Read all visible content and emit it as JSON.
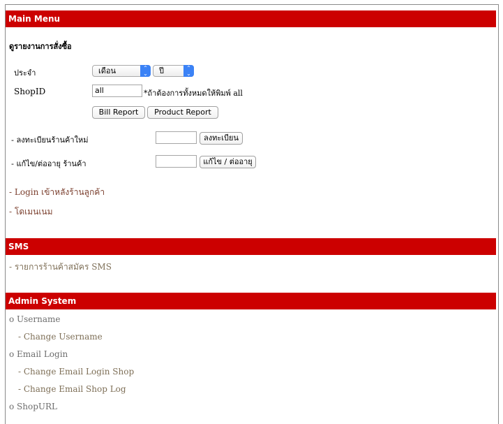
{
  "main_menu": {
    "header": "Main Menu",
    "section_title": "ดูรายงานการสั่งซื้อ",
    "period_label": "ประจำ",
    "month_select": "เดือน",
    "year_select": "ปี",
    "shopid_label": "ShopID",
    "shopid_value": "all",
    "shopid_hint": "*ถ้าต้องการทั้งหมดให้พิมพ์ all",
    "bill_report_button": "Bill Report",
    "product_report_button": "Product Report",
    "register_label": "- ลงทะเบียนร้านค้าใหม่",
    "register_button": "ลงทะเบียน",
    "edit_label": "- แก้ไข/ต่ออายุ ร้านค้า",
    "edit_button": "แก้ไข / ต่ออายุ",
    "login_link": "- Login เข้าหลังร้านลูกค้า",
    "domain_link": "- โดเมนเนม"
  },
  "sms": {
    "header": "SMS",
    "list_link": "- รายการร้านค้าสมัคร SMS"
  },
  "admin": {
    "header": "Admin System",
    "username": "o Username",
    "change_username": "- Change Username",
    "email_login": "o Email Login",
    "change_email_login_shop": "- Change Email Login Shop",
    "change_email_shop_log": "- Change Email Shop Log",
    "shopurl": "o ShopURL"
  },
  "colors": {
    "header_bg": "#cc0000",
    "select_arrow": "#3b82f6"
  }
}
